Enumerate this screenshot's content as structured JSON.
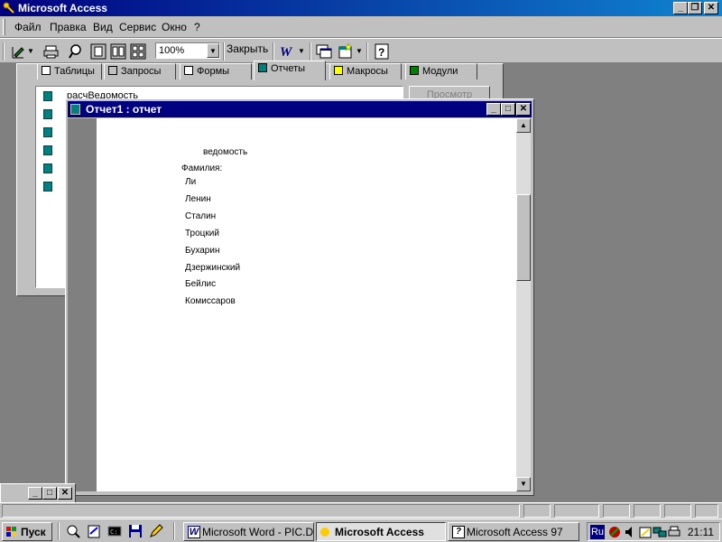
{
  "app": {
    "title": "Microsoft Access"
  },
  "menu": [
    "Файл",
    "Правка",
    "Вид",
    "Сервис",
    "Окно",
    "?"
  ],
  "toolbar": {
    "zoom": "100%",
    "close_label": "Закрыть"
  },
  "db_window": {
    "tabs": [
      "Таблицы",
      "Запросы",
      "Формы",
      "Отчеты",
      "Макросы",
      "Модули"
    ],
    "active_tab": "Отчеты",
    "first_item": "расчВедомость",
    "preview_button": "Просмотр"
  },
  "report_window": {
    "title": "Отчет1 : отчет",
    "header": "ведомость",
    "label": "Фамилия:",
    "names": [
      "Ли",
      "Ленин",
      "Сталин",
      "Троцкий",
      "Бухарин",
      "Дзержинский",
      "Бейлис",
      "Комиссаров"
    ]
  },
  "taskbar": {
    "start": "Пуск",
    "tasks": [
      "Microsoft Word - PIC.D...",
      "Microsoft Access",
      "Microsoft Access 97"
    ],
    "lang": "Ru",
    "clock": "21:11"
  },
  "colors": {
    "title_active": "#000080",
    "face": "#c0c0c0",
    "desktop": "#808080"
  }
}
